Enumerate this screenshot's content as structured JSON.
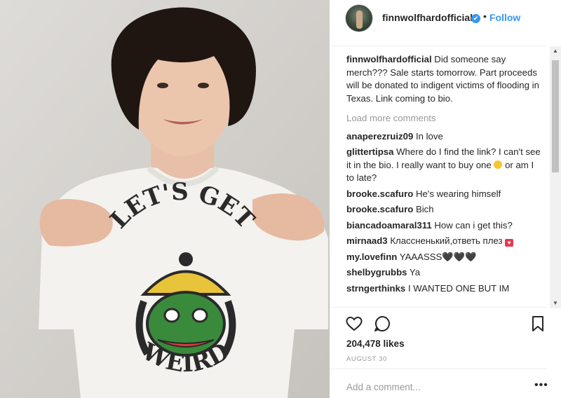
{
  "post": {
    "shirt_text_top": "LET'S GET",
    "shirt_text_bottom": "WEIRD"
  },
  "header": {
    "username": "finnwolfhardofficial",
    "verified_mark": "✔",
    "separator": "•",
    "follow_label": "Follow"
  },
  "caption": {
    "user": "finnwolfhardofficial",
    "text": "Did someone say merch??? Sale starts tomorrow. Part proceeds will be donated to indigent victims of flooding in Texas. Link coming to bio."
  },
  "load_more_label": "Load more comments",
  "comments": [
    {
      "user": "anaperezruiz09",
      "text": "In love"
    },
    {
      "user": "glittertipsa",
      "text": "Where do I find the link? I can't see it in the bio. I really want to buy one",
      "text2": "or am I to late?"
    },
    {
      "user": "brooke.scafuro",
      "text": "He's wearing himself"
    },
    {
      "user": "brooke.scafuro",
      "text": "Bich"
    },
    {
      "user": "biancadoamaral311",
      "text": "How can i get this?"
    },
    {
      "user": "mirnaad3",
      "text": "Классненький,ответь плез"
    },
    {
      "user": "my.lovefinn",
      "text": "YAAASSS🖤🖤🖤"
    },
    {
      "user": "shelbygrubbs",
      "text": "Ya"
    },
    {
      "user": "strngerthinks",
      "text": "I WANTED ONE BUT IM"
    }
  ],
  "likes": "204,478 likes",
  "date": "AUGUST 30",
  "add_comment_placeholder": "Add a comment...",
  "more_label": "•••",
  "icons": [
    "heart-icon",
    "comment-icon",
    "bookmark-icon",
    "verified-icon",
    "more-options-icon"
  ],
  "colors": {
    "link": "#3897f0",
    "text": "#262626",
    "muted": "#999999"
  }
}
